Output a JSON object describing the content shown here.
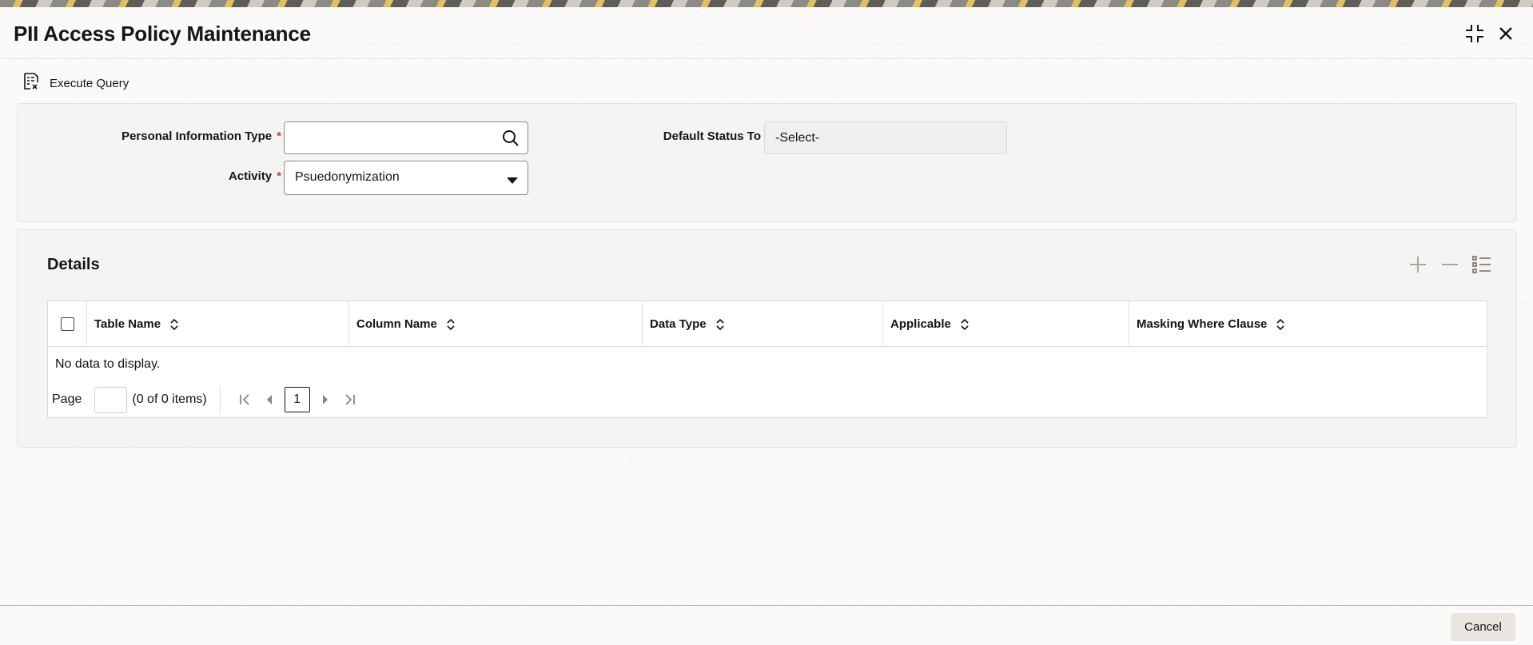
{
  "window": {
    "title": "PII Access Policy Maintenance",
    "collapse_icon": "collapse-icon",
    "close_icon": "close-icon"
  },
  "toolbar": {
    "execute_query_label": "Execute Query",
    "execute_query_icon": "query-document-icon"
  },
  "form": {
    "personal_info_type": {
      "label": "Personal Information Type",
      "required_mark": "*",
      "value": "",
      "icon": "search-icon"
    },
    "activity": {
      "label": "Activity",
      "required_mark": "*",
      "selected": "Psuedonymization",
      "icon": "caret-down-icon"
    },
    "default_status_to": {
      "label": "Default Status To",
      "selected": "-Select-"
    }
  },
  "details": {
    "title": "Details",
    "actions": [
      "add-icon",
      "remove-icon",
      "list-view-icon"
    ],
    "columns": [
      "Table Name",
      "Column Name",
      "Data Type",
      "Applicable",
      "Masking Where Clause"
    ],
    "empty_text": "No data to display.",
    "pager": {
      "page_label": "Page",
      "page_value": "",
      "items_text": "(0 of 0 items)",
      "current_page": "1"
    }
  },
  "footer": {
    "cancel_label": "Cancel"
  },
  "colors": {
    "required": "#c74634",
    "text": "#161513",
    "panel_bg": "#f5f4f2"
  }
}
